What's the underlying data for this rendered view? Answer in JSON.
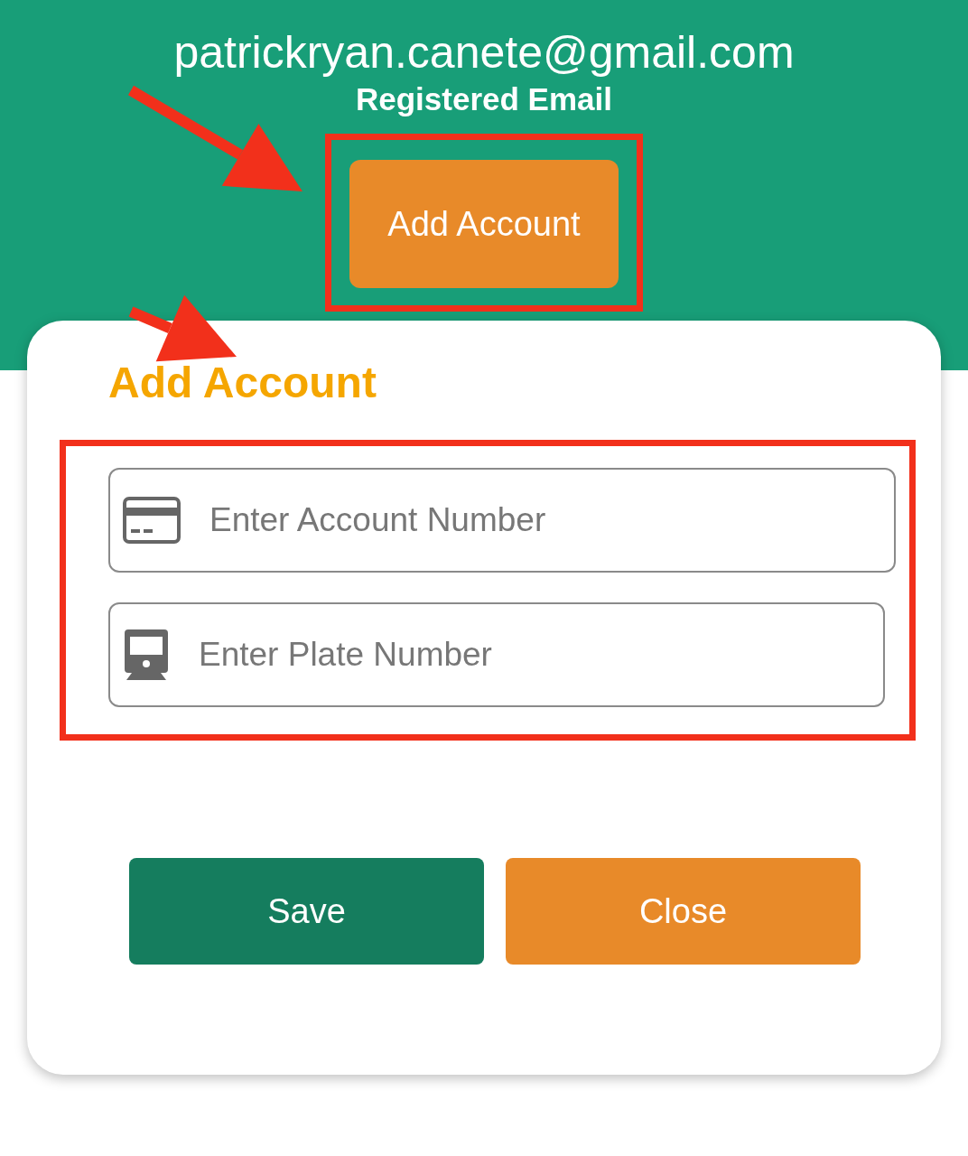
{
  "header": {
    "email": "patrickryan.canete@gmail.com",
    "email_label": "Registered Email",
    "add_button": "Add Account"
  },
  "dialog": {
    "title": "Add Account",
    "fields": [
      {
        "kind": "card",
        "placeholder": "Enter Account Number"
      },
      {
        "kind": "vehicle",
        "placeholder": "Enter Plate Number"
      }
    ],
    "buttons": [
      {
        "kind": "primary",
        "label": "Save"
      },
      {
        "kind": "secondary",
        "label": "Close"
      }
    ]
  }
}
